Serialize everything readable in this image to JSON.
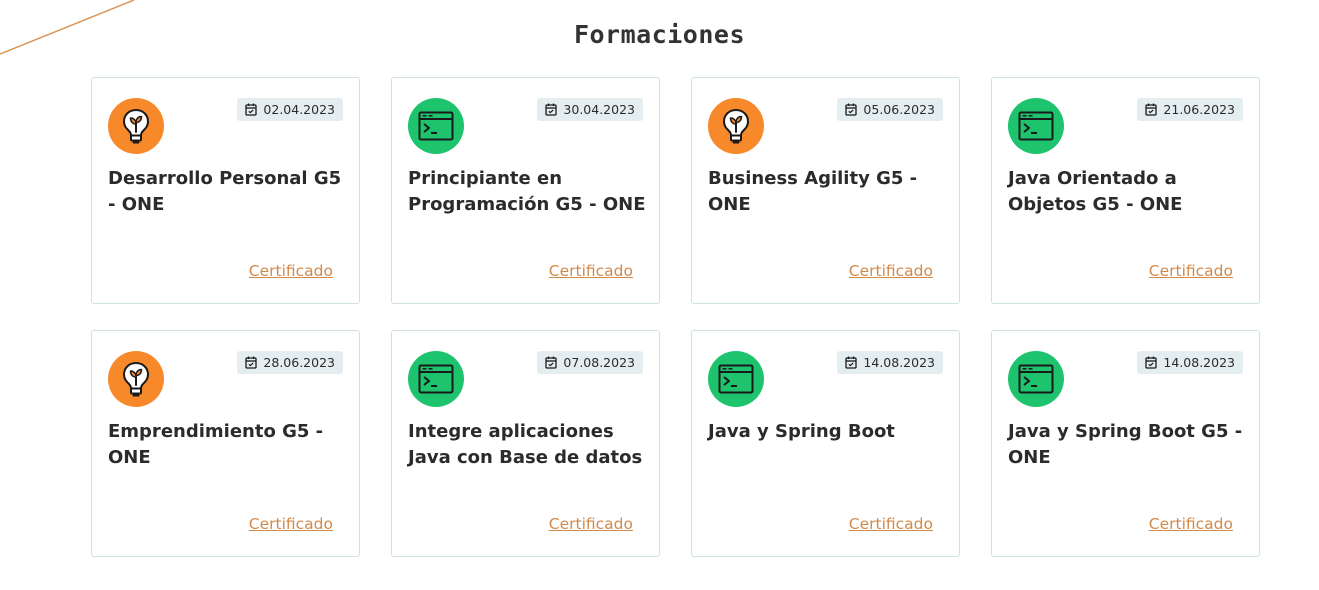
{
  "section": {
    "title": "Formaciones"
  },
  "colors": {
    "accent_orange": "#f7892a",
    "accent_green": "#1ec36e",
    "link": "#d28a4b",
    "badge_bg": "#e4eef0",
    "border": "#cfe1e3",
    "deco_line": "#d99657"
  },
  "cards": [
    {
      "icon": "lightbulb-plant-icon",
      "date": "02.04.2023",
      "title": "Desarrollo Personal G5 - ONE",
      "link_label": "Certificado"
    },
    {
      "icon": "terminal-window-icon",
      "date": "30.04.2023",
      "title": "Principiante en Programación G5 - ONE",
      "link_label": "Certificado"
    },
    {
      "icon": "lightbulb-plant-icon",
      "date": "05.06.2023",
      "title": "Business Agility G5 - ONE",
      "link_label": "Certificado"
    },
    {
      "icon": "terminal-window-icon",
      "date": "21.06.2023",
      "title": "Java Orientado a Objetos G5 - ONE",
      "link_label": "Certificado"
    },
    {
      "icon": "lightbulb-plant-icon",
      "date": "28.06.2023",
      "title": "Emprendimiento G5 - ONE",
      "link_label": "Certificado"
    },
    {
      "icon": "terminal-window-icon",
      "date": "07.08.2023",
      "title": "Integre aplicaciones Java con Base de datos",
      "link_label": "Certificado"
    },
    {
      "icon": "terminal-window-icon",
      "date": "14.08.2023",
      "title": "Java y Spring Boot",
      "link_label": "Certificado"
    },
    {
      "icon": "terminal-window-icon",
      "date": "14.08.2023",
      "title": "Java y Spring Boot G5 - ONE",
      "link_label": "Certificado"
    }
  ]
}
